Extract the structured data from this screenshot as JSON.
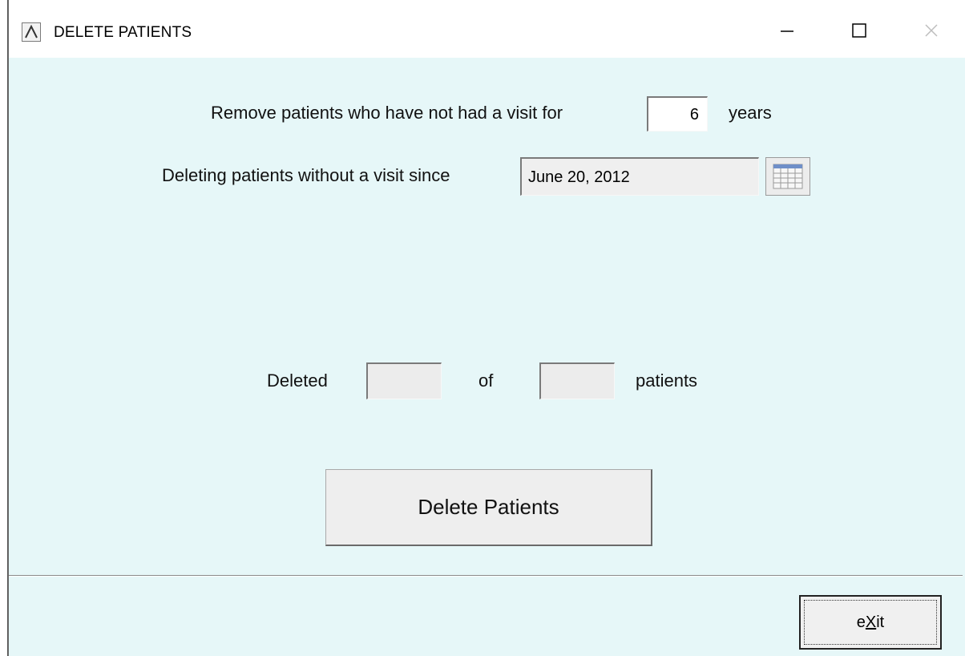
{
  "window": {
    "title": "DELETE PATIENTS",
    "controls": {
      "minimize_icon": "minimize-icon",
      "maximize_icon": "maximize-icon",
      "close_icon": "close-icon"
    }
  },
  "form": {
    "remove_label": "Remove patients who have not had a visit for",
    "years_value": "6",
    "years_unit": "years",
    "since_label": "Deleting patients without a visit since",
    "since_date": "June 20, 2012",
    "calendar_icon": "calendar-icon"
  },
  "progress": {
    "deleted_label": "Deleted",
    "deleted_value": "",
    "of_label": "of",
    "total_value": "",
    "patients_label": "patients"
  },
  "actions": {
    "delete_button": "Delete Patients",
    "exit_button_prefix": "e",
    "exit_button_accel": "X",
    "exit_button_suffix": "it"
  },
  "colors": {
    "background": "#e6f7f8",
    "titlebar": "#ffffff",
    "button_face": "#eeeeee"
  }
}
